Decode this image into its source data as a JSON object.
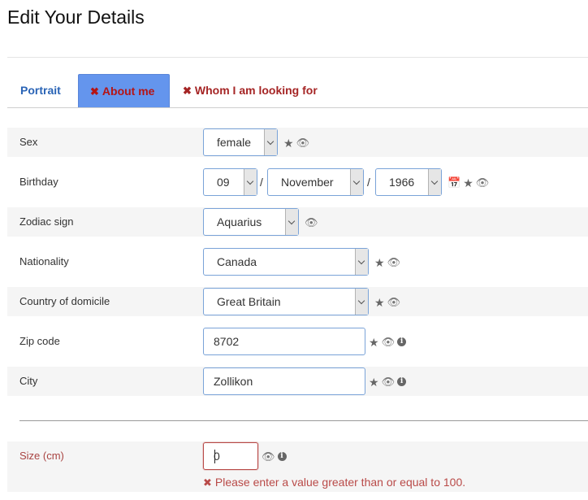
{
  "title": "Edit Your Details",
  "tabs": [
    {
      "label": "Portrait"
    },
    {
      "label": "About me"
    },
    {
      "label": "Whom I am looking for"
    }
  ],
  "fields": {
    "sex": {
      "label": "Sex",
      "value": "female"
    },
    "birthday": {
      "label": "Birthday",
      "day": "09",
      "month": "November",
      "year": "1966",
      "separator": "/"
    },
    "zodiac": {
      "label": "Zodiac sign",
      "value": "Aquarius"
    },
    "nationality": {
      "label": "Nationality",
      "value": "Canada"
    },
    "domicile": {
      "label": "Country of domicile",
      "value": "Great Britain"
    },
    "zip": {
      "label": "Zip code",
      "value": "8702"
    },
    "city": {
      "label": "City",
      "value": "Zollikon"
    },
    "size": {
      "label": "Size (cm)",
      "value": "0",
      "error": "Please enter a value greater than or equal to 100."
    }
  },
  "icons": {
    "star": "★",
    "eye": "👁",
    "info": "i",
    "calendar": "📅",
    "x": "✖"
  },
  "colors": {
    "active_tab_bg": "#6495ed",
    "error": "#b94a48",
    "link": "#2a64b6"
  }
}
